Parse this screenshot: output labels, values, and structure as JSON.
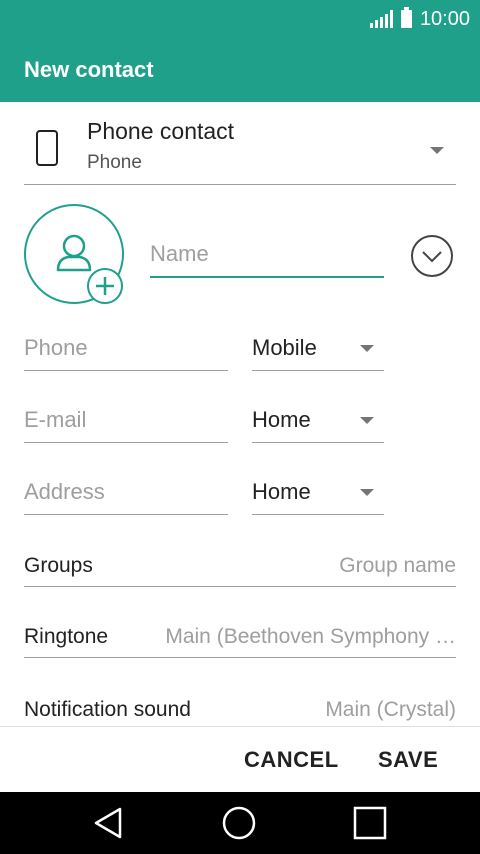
{
  "status_bar": {
    "time": "10:00"
  },
  "app_bar": {
    "title": "New contact"
  },
  "account": {
    "title": "Phone contact",
    "subtitle": "Phone"
  },
  "name_field": {
    "placeholder": "Name"
  },
  "fields": [
    {
      "placeholder": "Phone",
      "type": "Mobile"
    },
    {
      "placeholder": "E-mail",
      "type": "Home"
    },
    {
      "placeholder": "Address",
      "type": "Home"
    }
  ],
  "groups": {
    "label": "Groups",
    "value": "Group name"
  },
  "ringtone": {
    "label": "Ringtone",
    "value": "Main (Beethoven Symphony …"
  },
  "notification": {
    "label": "Notification sound",
    "value": "Main (Crystal)"
  },
  "buttons": {
    "cancel": "CANCEL",
    "save": "SAVE"
  },
  "colors": {
    "accent": "#1fa08a"
  },
  "icons": [
    "signal-icon",
    "battery-icon",
    "phone-device-icon",
    "dropdown-arrow-icon",
    "person-icon",
    "add-icon",
    "expand-icon",
    "nav-back-icon",
    "nav-home-icon",
    "nav-recents-icon"
  ]
}
